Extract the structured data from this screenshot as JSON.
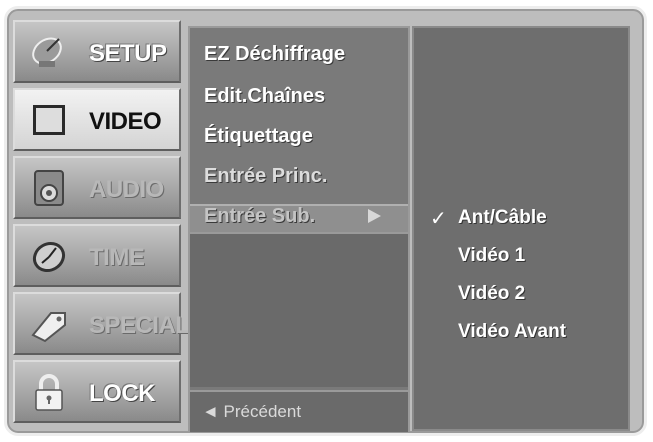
{
  "tabs": [
    {
      "label": "SETUP",
      "icon": "satellite-dish-icon",
      "state": "normal"
    },
    {
      "label": "VIDEO",
      "icon": "screen-icon",
      "state": "active"
    },
    {
      "label": "AUDIO",
      "icon": "speaker-icon",
      "state": "dim"
    },
    {
      "label": "TIME",
      "icon": "clock-icon",
      "state": "dim"
    },
    {
      "label": "SPECIAL",
      "icon": "tag-icon",
      "state": "dim"
    },
    {
      "label": "LOCK",
      "icon": "padlock-icon",
      "state": "normal"
    }
  ],
  "submenu": {
    "items": [
      "EZ Déchiffrage",
      "Edit.Chaînes",
      "Étiquettage",
      "Entrée Princ.",
      "Entrée Sub."
    ],
    "selected_index": 4,
    "back_label": "◄ Précédent"
  },
  "options": {
    "items": [
      "Ant/Câble",
      "Vidéo 1",
      "Vidéo 2",
      "Vidéo Avant"
    ],
    "checked_index": 0,
    "check_glyph": "✓"
  },
  "colors": {
    "frame": "#bdbdbd",
    "panel": "#7a7a7a",
    "text": "#ffffff"
  }
}
